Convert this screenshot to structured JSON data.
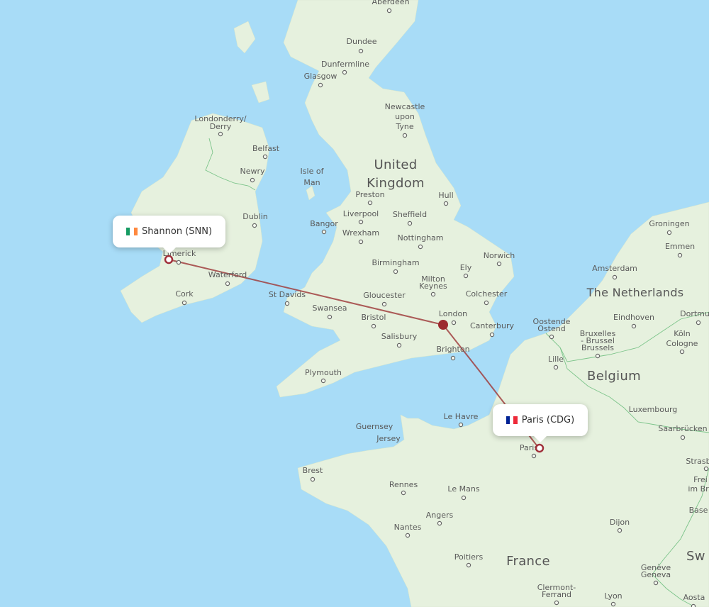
{
  "route": {
    "color": "#a0403f",
    "origin": {
      "city": "Shannon",
      "code": "SNN",
      "label": "Shannon (SNN)",
      "flag_colors": [
        "#169b62",
        "#ffffff",
        "#ff883e"
      ]
    },
    "stopover": {
      "city": "London"
    },
    "destination": {
      "city": "Paris",
      "code": "CDG",
      "label": "Paris (CDG)",
      "flag_colors": [
        "#002395",
        "#ffffff",
        "#ed2939"
      ]
    }
  },
  "countries": {
    "uk_line1": "United",
    "uk_line2": "Kingdom",
    "netherlands": "The Netherlands",
    "belgium": "Belgium",
    "france": "France",
    "switzerland_partial": "Sw"
  },
  "cities": {
    "aberdeen": "Aberdeen",
    "dundee": "Dundee",
    "dunfermline": "Dunfermline",
    "glasgow": "Glasgow",
    "newcastle1": "Newcastle",
    "newcastle2": "upon",
    "newcastle3": "Tyne",
    "londonderry1": "Londonderry/",
    "londonderry2": "Derry",
    "belfast": "Belfast",
    "newry": "Newry",
    "isle1": "Isle of",
    "isle2": "Man",
    "dublin": "Dublin",
    "limerick": "Limerick",
    "waterford": "Waterford",
    "cork": "Cork",
    "preston": "Preston",
    "hull": "Hull",
    "liverpool": "Liverpool",
    "sheffield": "Sheffield",
    "bangor": "Bangor",
    "wrexham": "Wrexham",
    "nottingham": "Nottingham",
    "norwich": "Norwich",
    "birmingham": "Birmingham",
    "ely": "Ely",
    "milton1": "Milton",
    "milton2": "Keynes",
    "st_davids": "St Davids",
    "gloucester": "Gloucester",
    "colchester": "Colchester",
    "swansea": "Swansea",
    "bristol": "Bristol",
    "london": "London",
    "canterbury": "Canterbury",
    "salisbury": "Salisbury",
    "brighton": "Brighton",
    "plymouth": "Plymouth",
    "groningen": "Groningen",
    "emmen": "Emmen",
    "amsterdam": "Amsterdam",
    "eindhoven": "Eindhoven",
    "dortmund": "Dortmu",
    "oostende1": "Oostende",
    "oostende2": "Ostend",
    "bruxelles1": "Bruxelles",
    "bruxelles2": "- Brussel",
    "bruxelles3": "Brussels",
    "koln1": "Köln",
    "koln2": "Cologne",
    "lille": "Lille",
    "luxembourg": "Luxembourg",
    "saarbrucken": "Saarbrücken",
    "le_havre": "Le Havre",
    "guernsey": "Guernsey",
    "jersey": "Jersey",
    "paris": "Paris",
    "brest": "Brest",
    "rennes": "Rennes",
    "le_mans": "Le Mans",
    "angers": "Angers",
    "nantes": "Nantes",
    "dijon": "Dijon",
    "poitiers": "Poitiers",
    "clermont1": "Clermont-",
    "clermont2": "Ferrand",
    "lyon": "Lyon",
    "geneve1": "Genève",
    "geneve2": "Geneva",
    "aosta": "Aosta",
    "strasbourg": "Strasb",
    "freiburg1": "Frei",
    "freiburg2": "im Br",
    "basel": "Base"
  }
}
